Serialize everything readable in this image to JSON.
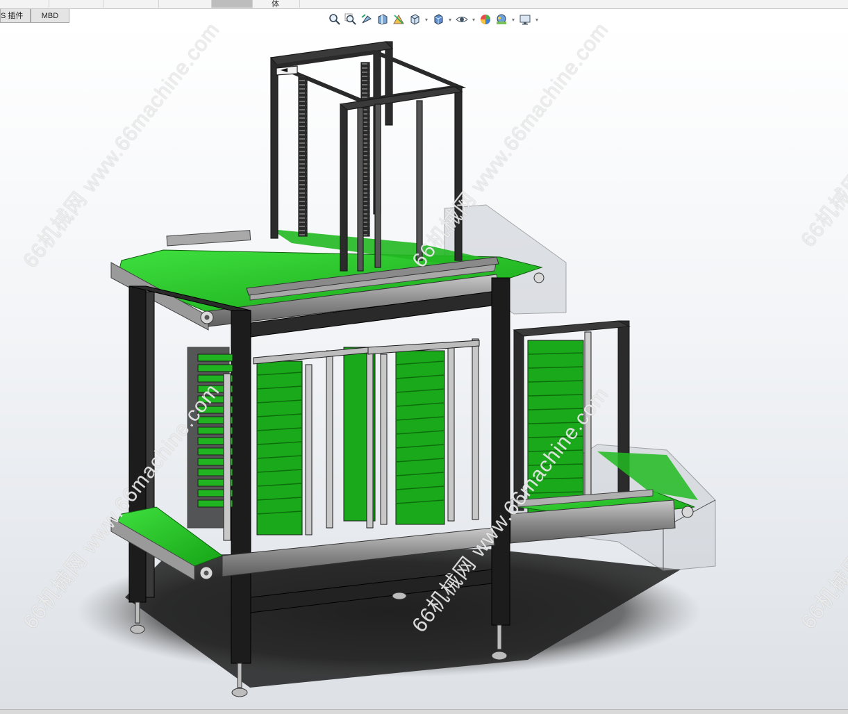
{
  "tabs": [
    {
      "label": "S 插件"
    },
    {
      "label": "MBD"
    }
  ],
  "top_tab": {
    "label": "体"
  },
  "toolbar": {
    "buttons": [
      {
        "name": "zoom-to-fit-icon"
      },
      {
        "name": "zoom-to-area-icon"
      },
      {
        "name": "previous-view-icon"
      },
      {
        "name": "section-view-icon"
      },
      {
        "name": "dynamic-annotation-icon"
      },
      {
        "name": "view-orientation-icon"
      },
      {
        "name": "display-style-icon"
      },
      {
        "name": "hide-show-items-icon"
      },
      {
        "name": "edit-appearance-icon"
      },
      {
        "name": "apply-scene-icon"
      },
      {
        "name": "view-settings-icon"
      }
    ]
  },
  "watermarks": [
    {
      "text": "66机械网 www.66machine.com"
    },
    {
      "text": "66机械网 www.66machine.com"
    },
    {
      "text": "66机械网"
    },
    {
      "text": "66机械网 www.66machine.com"
    },
    {
      "text": "66机械网 www.66machine.com"
    },
    {
      "text": "66机械网"
    }
  ],
  "colors": {
    "conveyor_belt": "#1fc21f",
    "frame_profile": "#1a1a1a",
    "sheet_metal": "#9a9a9a",
    "guard_glass": "#c9cdd3",
    "viewport_bg": "#eef0f3"
  }
}
